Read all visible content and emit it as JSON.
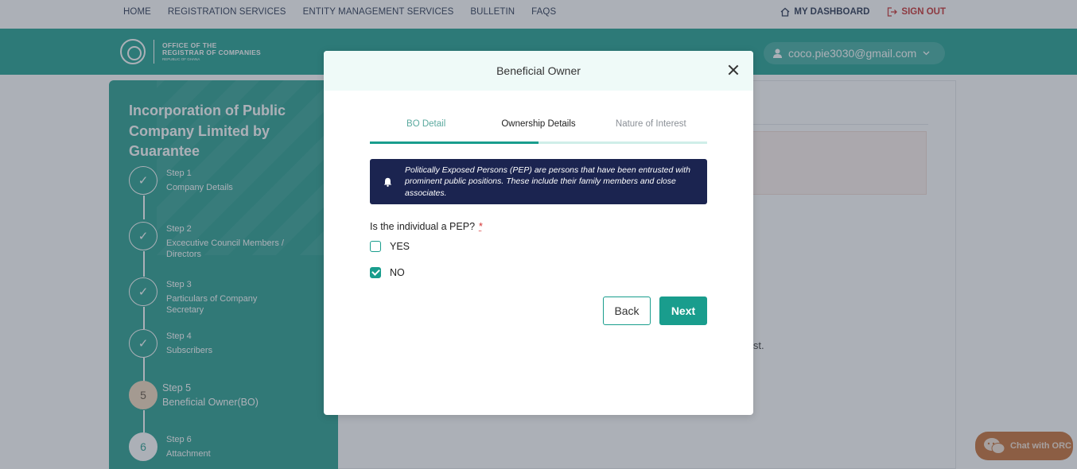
{
  "topnav": {
    "links": [
      "HOME",
      "REGISTRATION SERVICES",
      "ENTITY MANAGEMENT SERVICES",
      "BULLETIN",
      "FAQS"
    ],
    "dashboard": "MY DASHBOARD",
    "signout": "SIGN OUT"
  },
  "header": {
    "logo_line1": "OFFICE OF THE",
    "logo_line2": "REGISTRAR OF COMPANIES",
    "logo_line3": "REPUBLIC OF GHANA",
    "user_email": "coco.pie3030@gmail.com"
  },
  "sidebar": {
    "title": "Incorporation of Public Company Limited by Guarantee",
    "steps": [
      {
        "num": "Step 1",
        "label": "Company Details",
        "status": "done"
      },
      {
        "num": "Step 2",
        "label": "Excecutive Council Members / Directors",
        "status": "done"
      },
      {
        "num": "Step 3",
        "label": "Particulars of Company Secretary",
        "status": "done"
      },
      {
        "num": "Step 4",
        "label": "Subscribers",
        "status": "done"
      },
      {
        "num": "Step 5",
        "label": "Beneficial Owner(BO)",
        "status": "active",
        "badge": "5"
      },
      {
        "num": "Step 6",
        "label": "Attachment",
        "status": "pending",
        "badge": "6"
      }
    ]
  },
  "background": {
    "text_fragment": "ist."
  },
  "modal": {
    "title": "Beneficial Owner",
    "tabs": [
      "BO Detail",
      "Ownership Details",
      "Nature of Interest"
    ],
    "active_tab": 1,
    "notice": "Politically Exposed Persons (PEP) are persons that have been entrusted with prominent public positions. These include their family members and close associates.",
    "question": "Is the individual a PEP?",
    "required_mark": "*",
    "options": [
      {
        "label": "YES",
        "checked": false
      },
      {
        "label": "NO",
        "checked": true
      }
    ],
    "back_label": "Back",
    "next_label": "Next"
  },
  "chat": {
    "label": "Chat with ORC"
  },
  "colors": {
    "teal": "#199d8d",
    "navy": "#1b2450",
    "signout": "#c62828",
    "chat": "#c56b2e"
  }
}
